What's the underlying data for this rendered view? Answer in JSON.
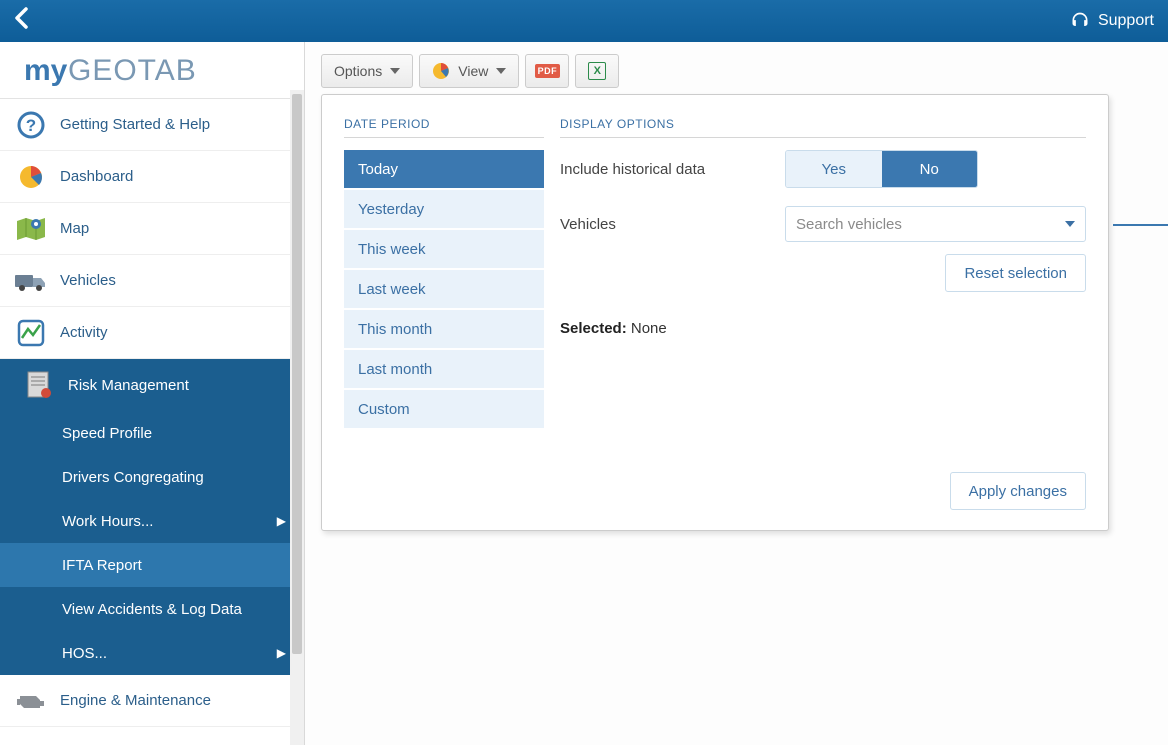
{
  "topbar": {
    "support_label": "Support"
  },
  "logo": {
    "prefix": "my",
    "suffix": "GEOTAB"
  },
  "sidebar": {
    "items": [
      {
        "label": "Getting Started & Help"
      },
      {
        "label": "Dashboard"
      },
      {
        "label": "Map"
      },
      {
        "label": "Vehicles"
      },
      {
        "label": "Activity"
      }
    ],
    "risk_header": "Risk Management",
    "sub_items": [
      {
        "label": "Speed Profile",
        "has_submenu": false,
        "selected": false
      },
      {
        "label": "Drivers Congregating",
        "has_submenu": false,
        "selected": false
      },
      {
        "label": "Work Hours...",
        "has_submenu": true,
        "selected": false
      },
      {
        "label": "IFTA Report",
        "has_submenu": false,
        "selected": true
      },
      {
        "label": "View Accidents & Log Data",
        "has_submenu": false,
        "selected": false
      },
      {
        "label": "HOS...",
        "has_submenu": true,
        "selected": false
      }
    ],
    "bottom_item": "Engine & Maintenance"
  },
  "toolbar": {
    "options_label": "Options",
    "view_label": "View",
    "pdf_label": "PDF",
    "xls_label": "X"
  },
  "panel": {
    "date_period_title": "DATE PERIOD",
    "display_options_title": "DISPLAY OPTIONS",
    "periods": [
      "Today",
      "Yesterday",
      "This week",
      "Last week",
      "This month",
      "Last month",
      "Custom"
    ],
    "active_period_index": 0,
    "include_historical_label": "Include historical data",
    "toggle_yes": "Yes",
    "toggle_no": "No",
    "include_historical_value": "No",
    "vehicles_label": "Vehicles",
    "vehicles_placeholder": "Search vehicles",
    "reset_label": "Reset selection",
    "selected_label": "Selected:",
    "selected_value": "None",
    "apply_label": "Apply changes"
  }
}
